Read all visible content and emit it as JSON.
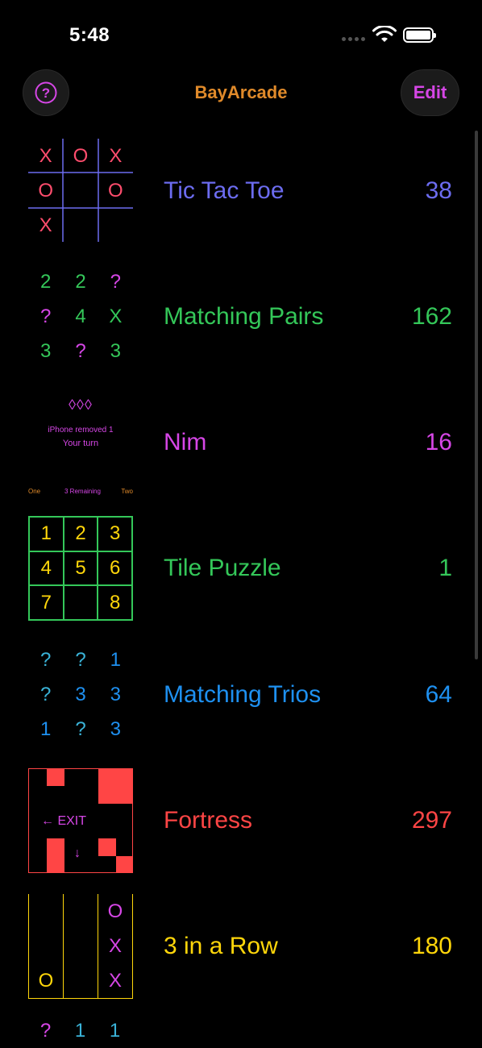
{
  "status_bar": {
    "time": "5:48"
  },
  "nav": {
    "title": "BayArcade",
    "help_icon": "question-circle-icon",
    "edit_label": "Edit"
  },
  "colors": {
    "purple": "#d646e6",
    "orange": "#e08a2a",
    "indigo": "#6c6cf0",
    "green": "#34c759",
    "blue": "#1e90f0",
    "red": "#ff4545",
    "yellow": "#ffd60a",
    "teal": "#3ab3d8"
  },
  "games": [
    {
      "title": "Tic Tac Toe",
      "score": "38",
      "color": "#6c6cf0",
      "preview": {
        "cells": [
          "X",
          "O",
          "X",
          "O",
          "",
          "O",
          "X",
          "",
          ""
        ]
      }
    },
    {
      "title": "Matching Pairs",
      "score": "162",
      "color": "#34c759",
      "preview": {
        "cells": [
          "2",
          "2",
          "?",
          "?",
          "4",
          "X",
          "3",
          "?",
          "3"
        ]
      }
    },
    {
      "title": "Nim",
      "score": "16",
      "color": "#d646e6",
      "preview": {
        "diamonds": "◊◊◊",
        "message": "iPhone removed 1",
        "turn": "Your turn",
        "player_one": "One",
        "remaining": "3 Remaining",
        "player_two": "Two"
      }
    },
    {
      "title": "Tile Puzzle",
      "score": "1",
      "color": "#34c759",
      "preview": {
        "cells": [
          "1",
          "2",
          "3",
          "4",
          "5",
          "6",
          "7",
          "",
          "8"
        ]
      }
    },
    {
      "title": "Matching Trios",
      "score": "64",
      "color": "#1e90f0",
      "preview": {
        "cells": [
          "?",
          "?",
          "1",
          "?",
          "3",
          "3",
          "1",
          "?",
          "3"
        ]
      }
    },
    {
      "title": "Fortress",
      "score": "297",
      "color": "#ff4545",
      "preview": {
        "exit_label": "← EXIT",
        "down_arrow": "↓"
      }
    },
    {
      "title": "3 in a Row",
      "score": "180",
      "color": "#ffd60a",
      "preview": {
        "pieces": [
          "O",
          "X",
          "X",
          "O"
        ]
      }
    }
  ],
  "next_row": {
    "cells": [
      "?",
      "1",
      "1"
    ]
  }
}
